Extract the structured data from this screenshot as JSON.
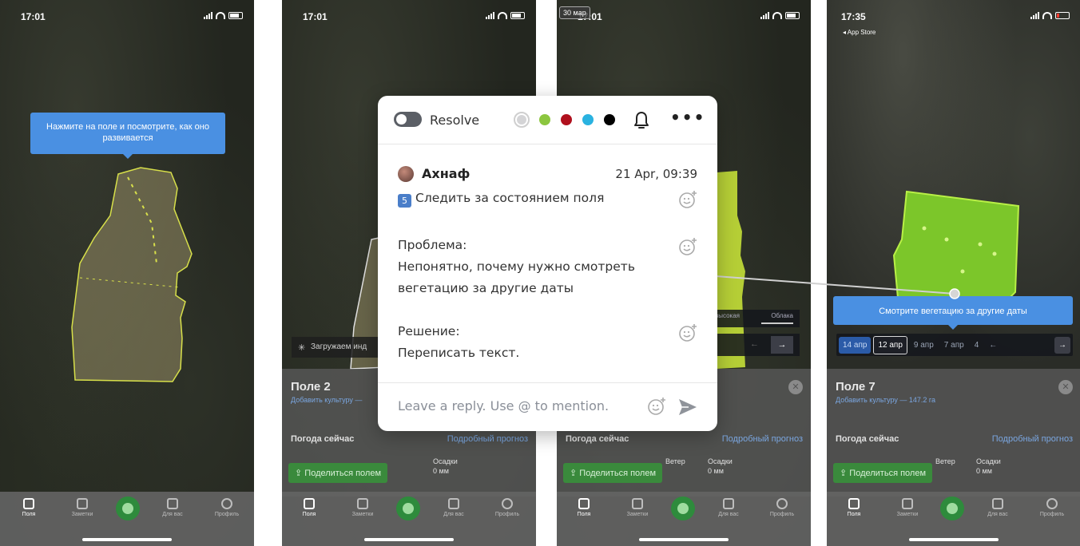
{
  "colors": {
    "accent_blue": "#4a90e2",
    "field_outline": "#d8e04a",
    "vegetation_green": "#8fd93a",
    "share_green": "#3a8a3c",
    "popup_dots": [
      "#d4d4d6",
      "#8cc63f",
      "#b0101d",
      "#2ab2e0",
      "#000000"
    ]
  },
  "phones": [
    {
      "status_time": "17:01",
      "tooltip": "Нажмите на поле и посмотрите, как оно развивается",
      "tabs": [
        "Поля",
        "Заметки",
        "",
        "Для вас",
        "Профиль"
      ]
    },
    {
      "status_time": "17:01",
      "loading_text": "Загружаем инд",
      "sheet_title": "Поле 2",
      "sheet_sub": "Добавить культуру —",
      "weather_label": "Погода сейчас",
      "forecast_link": "Подробный прогноз",
      "share_btn": "Поделиться полем",
      "precip_label": "Осадки",
      "precip_value": "0 мм",
      "tabs": [
        "Поля",
        "Заметки",
        "",
        "Для вас",
        "Профиль"
      ]
    },
    {
      "status_time": "17:01",
      "rec_badge": "30 мар",
      "legend_a": "высокая",
      "legend_b": "Облака",
      "sheet_sub": "",
      "weather_label": "Погода сейчас",
      "forecast_link": "Подробный прогноз",
      "share_btn": "Поделиться полем",
      "wind_label": "Ветер",
      "precip_label": "Осадки",
      "precip_value": "0 мм",
      "tabs": [
        "Поля",
        "Заметки",
        "",
        "Для вас",
        "Профиль"
      ]
    },
    {
      "status_time": "17:35",
      "status_back": "◂ App Store",
      "tooltip": "Смотрите вегетацию за другие даты",
      "dates": [
        "14 апр",
        "12 апр",
        "9 апр",
        "7 апр",
        "4"
      ],
      "sheet_title": "Поле 7",
      "sheet_sub": "Добавить культуру — 147.2 га",
      "weather_label": "Погода сейчас",
      "forecast_link": "Подробный прогноз",
      "share_btn": "Поделиться полем",
      "wind_label": "Ветер",
      "precip_label": "Осадки",
      "precip_value": "0 мм",
      "tabs": [
        "Поля",
        "Заметки",
        "",
        "Для вас",
        "Профиль"
      ]
    }
  ],
  "comment": {
    "resolve_label": "Resolve",
    "author": "Ахнаф",
    "date": "21 Apr, 09:39",
    "title_badge": "5",
    "title_text": "Следить за состоянием поля",
    "problem_label": "Проблема:",
    "problem_line1": "Непонятно, почему нужно смотреть",
    "problem_line2": "вегетацию за другие даты",
    "solution_label": "Решение:",
    "solution_text": "Переписать текст.",
    "reply_placeholder": "Leave a reply. Use @ to mention.",
    "icons": [
      "toggle-icon",
      "bell-icon",
      "more-icon",
      "add-reaction-icon",
      "send-icon"
    ]
  }
}
